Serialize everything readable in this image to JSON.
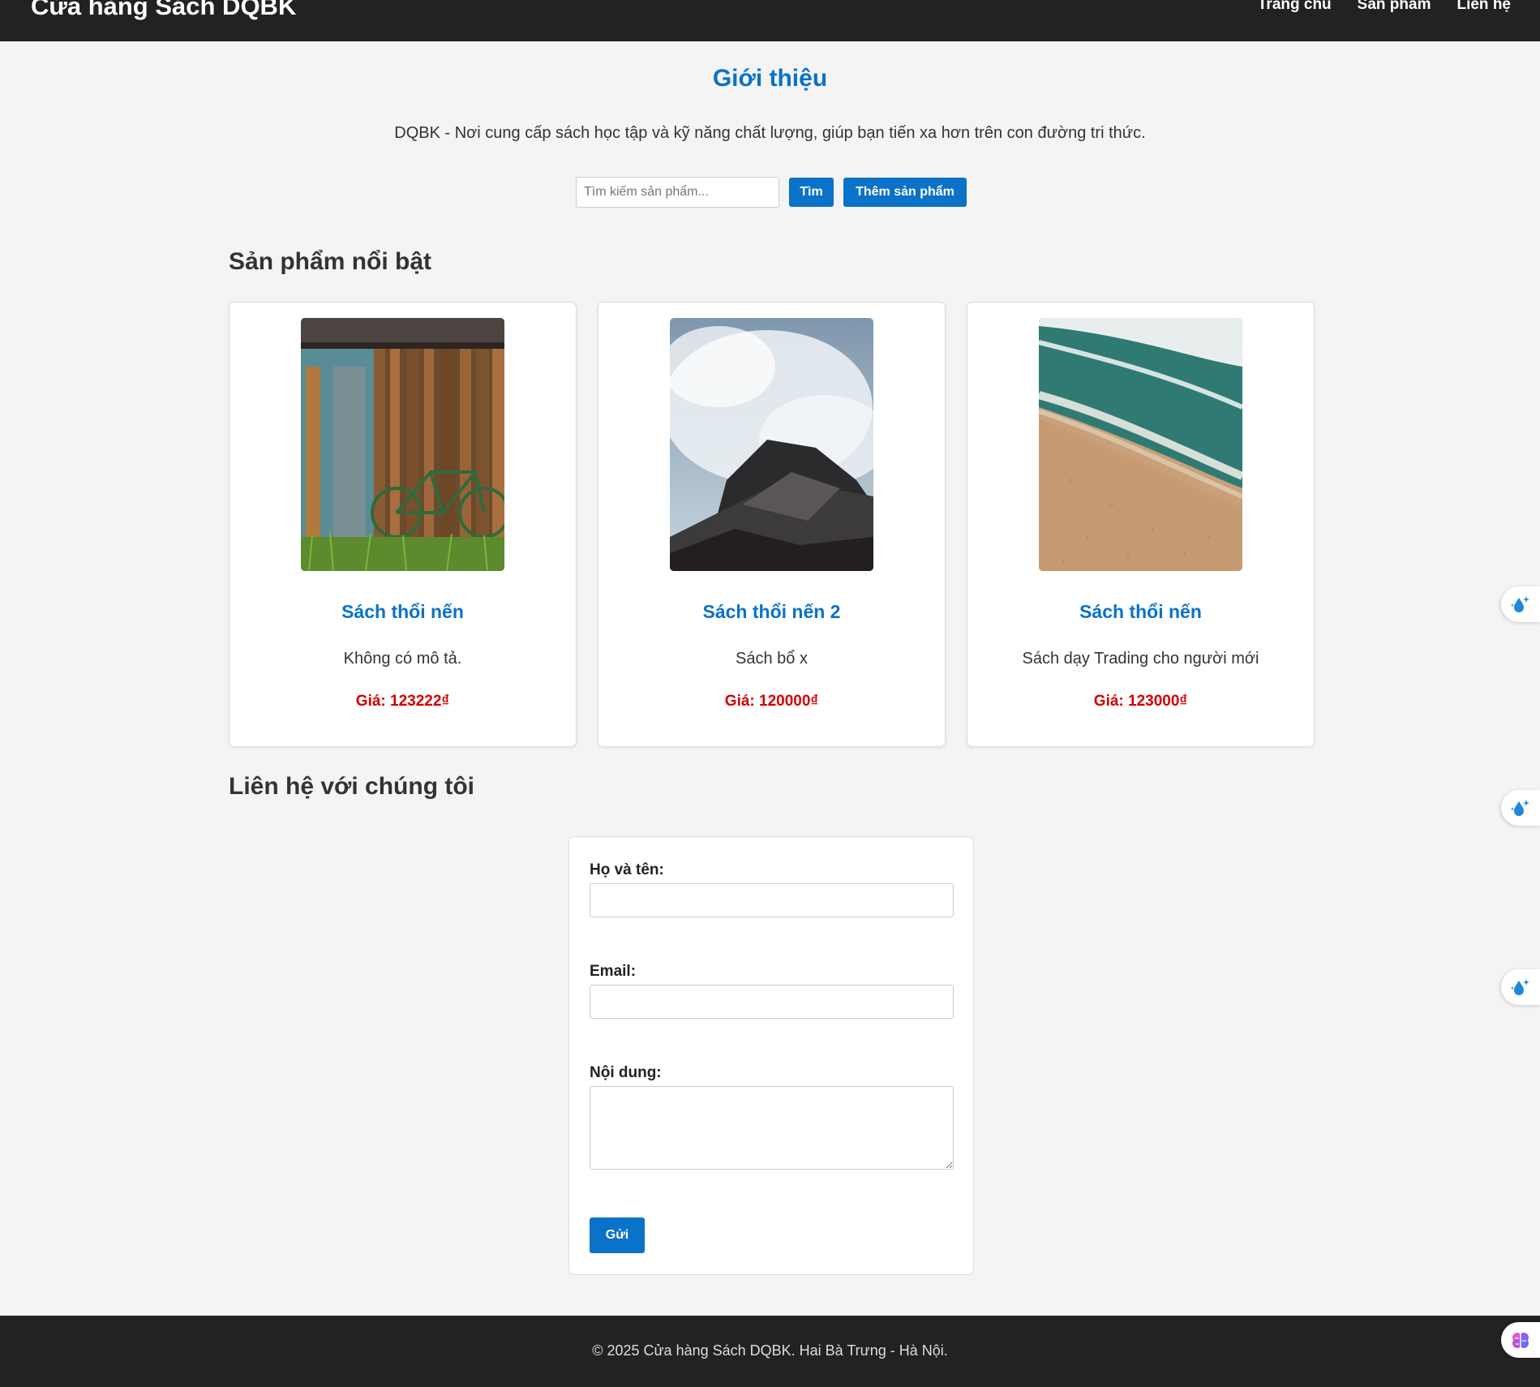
{
  "header": {
    "brand": "Cửa hàng Sách DQBK",
    "nav": [
      "Trang chủ",
      "Sản phẩm",
      "Liên hệ"
    ]
  },
  "intro": {
    "title": "Giới thiệu",
    "text": "DQBK - Nơi cung cấp sách học tập và kỹ năng chất lượng, giúp bạn tiến xa hơn trên con đường tri thức."
  },
  "search": {
    "placeholder": "Tìm kiếm sản phẩm...",
    "search_button": "Tìm",
    "add_button": "Thêm sản phẩm"
  },
  "products_section": {
    "title": "Sản phẩm nổi bật",
    "items": [
      {
        "title": "Sách thổi nến",
        "description": "Không có mô tả.",
        "price": "Giá: 123222₫",
        "image": "wooden-shed-bicycle-photo"
      },
      {
        "title": "Sách thổi nến 2",
        "description": "Sách bổ x",
        "price": "Giá: 120000₫",
        "image": "wave-on-rock-photo"
      },
      {
        "title": "Sách thổi nến",
        "description": "Sách dạy Trading cho người mới",
        "price": "Giá: 123000₫",
        "image": "beach-aerial-photo"
      }
    ]
  },
  "contact": {
    "title": "Liên hệ với chúng tôi",
    "name_label": "Họ và tên:",
    "name_value": "",
    "email_label": "Email:",
    "email_value": "",
    "message_label": "Nội dung:",
    "message_value": "",
    "submit": "Gửi"
  },
  "footer": {
    "text": "© 2025 Cửa hàng Sách DQBK. Hai Bà Trưng - Hà Nội."
  },
  "side_widgets": [
    "water-drop-sparkle-icon",
    "water-drop-sparkle-icon",
    "water-drop-sparkle-icon",
    "brain-icon"
  ],
  "colors": {
    "accent": "#0a72c8",
    "price": "#d40000",
    "header_bg": "#222222",
    "page_bg": "#f4f4f4"
  }
}
